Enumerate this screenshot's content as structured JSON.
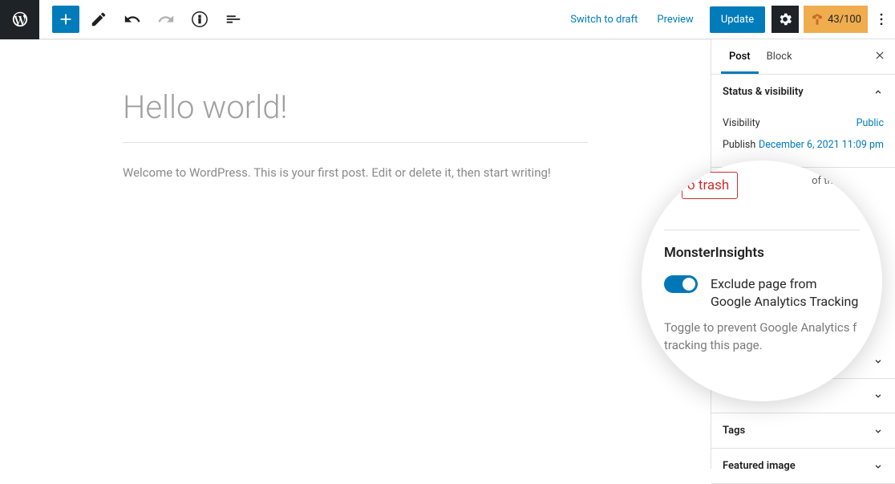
{
  "topbar": {
    "switch_draft": "Switch to draft",
    "preview": "Preview",
    "update": "Update",
    "health_score": "43/100"
  },
  "editor": {
    "title": "Hello world!",
    "body": "Welcome to WordPress. This is your first post. Edit or delete it, then start writing!"
  },
  "sidebar": {
    "tabs": {
      "post": "Post",
      "block": "Block"
    },
    "status": {
      "title": "Status & visibility",
      "visibility_label": "Visibility",
      "visibility_value": "Public",
      "publish_label": "Publish",
      "publish_value": "December 6, 2021 11:09 pm"
    },
    "panels": {
      "tags": "Tags",
      "featured_image": "Featured image"
    }
  },
  "magnify": {
    "trash": "o trash",
    "blog_fragment": "of the blog",
    "section_title": "MonsterInsights",
    "toggle_label": "Exclude page from Google Analytics Tracking",
    "description": "Toggle to prevent Google Analytics f tracking this page."
  }
}
